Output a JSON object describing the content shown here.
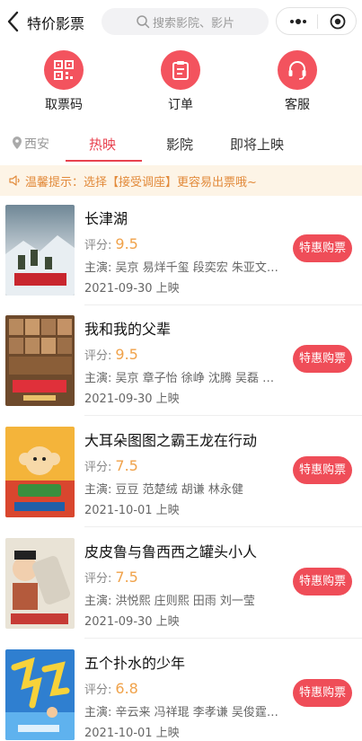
{
  "nav": {
    "title": "特价影票",
    "search_placeholder": "搜索影院、影片"
  },
  "quick_actions": [
    {
      "label": "取票码",
      "icon": "qr-code-icon"
    },
    {
      "label": "订单",
      "icon": "clipboard-icon"
    },
    {
      "label": "客服",
      "icon": "headset-icon"
    }
  ],
  "tabs": {
    "city": "西安",
    "items": [
      "热映",
      "影院",
      "即将上映"
    ],
    "active": "热映"
  },
  "notice": "温馨提示：选择【接受调座】更容易出票哦~",
  "movies": [
    {
      "name": "长津湖",
      "score_label": "评分:",
      "score": "9.5",
      "cast": "主演: 吴京 易烊千玺 段奕宏 朱亚文…",
      "date": "2021-09-30 上映",
      "button": "特惠购票"
    },
    {
      "name": "我和我的父辈",
      "score_label": "评分:",
      "score": "9.5",
      "cast": "主演: 吴京 章子怡 徐峥 沈腾 吴磊 …",
      "date": "2021-09-30 上映",
      "button": "特惠购票"
    },
    {
      "name": "大耳朵图图之霸王龙在行动",
      "score_label": "评分:",
      "score": "7.5",
      "cast": "主演: 豆豆 范楚绒 胡谦 林永健",
      "date": "2021-10-01 上映",
      "button": "特惠购票"
    },
    {
      "name": "皮皮鲁与鲁西西之罐头小人",
      "score_label": "评分:",
      "score": "7.5",
      "cast": "主演: 洪悦熙 庄则熙 田雨 刘一莹",
      "date": "2021-09-30 上映",
      "button": "特惠购票"
    },
    {
      "name": "五个扑水的少年",
      "score_label": "评分:",
      "score": "6.8",
      "cast": "主演: 辛云来 冯祥琨 李孝谦 吴俊霆…",
      "date": "2021-10-01 上映",
      "button": "特惠购票"
    }
  ],
  "colors": {
    "accent": "#e8424f",
    "button": "#ef4d58",
    "score": "#f0a24a",
    "notice_bg": "#fdf4e6",
    "notice_text": "#e28a3a"
  }
}
